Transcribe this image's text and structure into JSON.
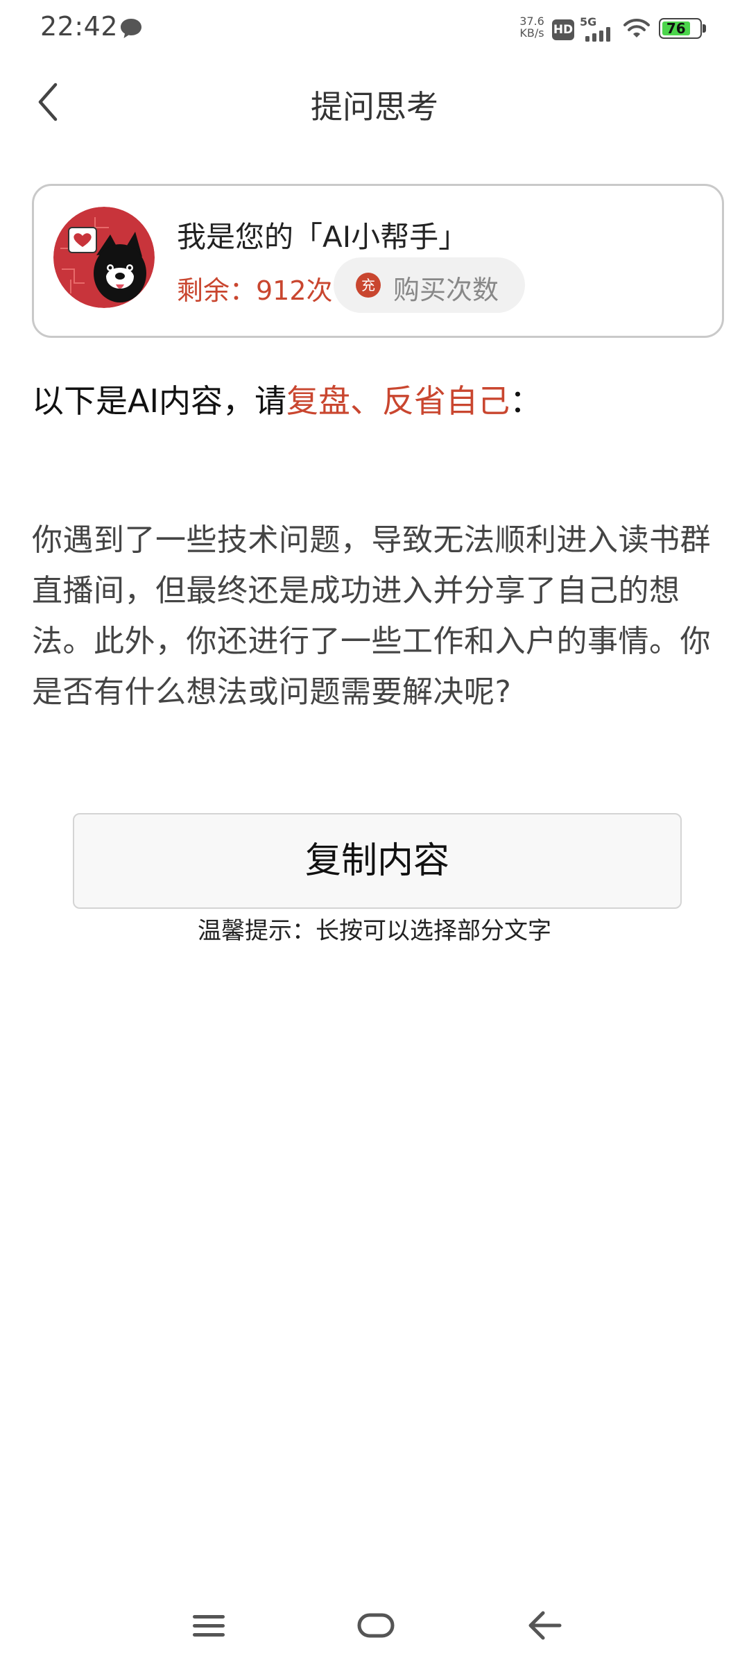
{
  "status_bar": {
    "time": "22:42",
    "speed_value": "37.6",
    "speed_unit": "KB/s",
    "hd_label": "HD",
    "network_label": "5G",
    "battery_level": "76",
    "battery_color": "#4cd54c"
  },
  "header": {
    "title": "提问思考"
  },
  "assistant_card": {
    "name": "我是您的「AI小帮手」",
    "remaining": "剩余：912次",
    "charge_icon_label": "充",
    "buy_label": "购买次数",
    "accent_color": "#c9462f"
  },
  "intro": {
    "prefix": "以下是AI内容，请",
    "highlight": "复盘、反省自己",
    "suffix": "："
  },
  "ai_content": {
    "text": "你遇到了一些技术问题，导致无法顺利进入读书群直播间，但最终还是成功进入并分享了自己的想法。此外，你还进行了一些工作和入户的事情。你是否有什么想法或问题需要解决呢?"
  },
  "actions": {
    "copy_label": "复制内容",
    "tip": "温馨提示：长按可以选择部分文字"
  },
  "icons": {
    "back": "chevron-left-icon",
    "avatar": "dog-heart-avatar",
    "nav_menu": "menu-icon",
    "nav_home": "home-icon",
    "nav_back": "back-arrow-icon"
  }
}
